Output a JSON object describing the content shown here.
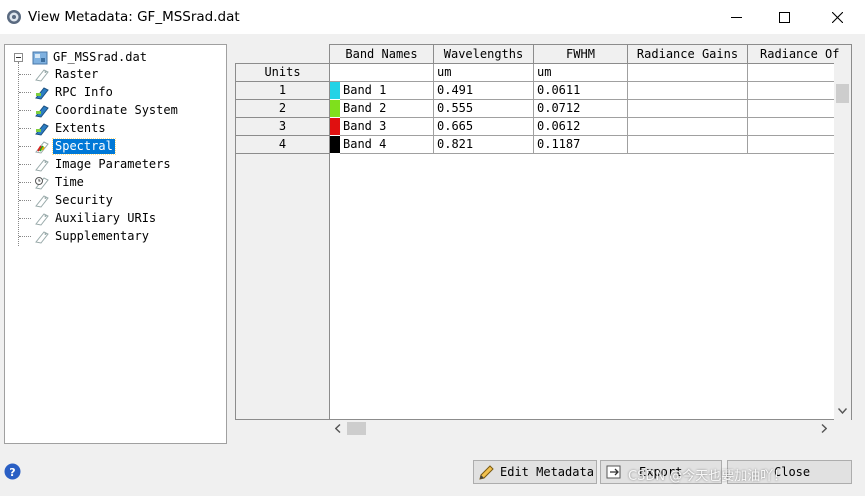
{
  "window": {
    "title": "View Metadata: GF_MSSrad.dat",
    "icon": "envi-gear-icon"
  },
  "tree": {
    "root": "GF_MSSrad.dat",
    "items": [
      {
        "label": "Raster",
        "icon": "tag-blank-icon",
        "selected": false
      },
      {
        "label": "RPC Info",
        "icon": "tag-filled-icon",
        "selected": false
      },
      {
        "label": "Coordinate System",
        "icon": "tag-filled-icon",
        "selected": false
      },
      {
        "label": "Extents",
        "icon": "tag-filled-icon",
        "selected": false
      },
      {
        "label": "Spectral",
        "icon": "tag-color-icon",
        "selected": true
      },
      {
        "label": "Image Parameters",
        "icon": "tag-blank-icon",
        "selected": false
      },
      {
        "label": "Time",
        "icon": "tag-clock-icon",
        "selected": false
      },
      {
        "label": "Security",
        "icon": "tag-blank-icon",
        "selected": false
      },
      {
        "label": "Auxiliary URIs",
        "icon": "tag-blank-icon",
        "selected": false
      },
      {
        "label": "Supplementary",
        "icon": "tag-blank-icon",
        "selected": false
      }
    ]
  },
  "grid": {
    "columns": [
      "Band Names",
      "Wavelengths",
      "FWHM",
      "Radiance Gains",
      "Radiance Of"
    ],
    "units_label": "Units",
    "units": [
      "",
      "um",
      "um",
      "",
      ""
    ],
    "rows": [
      {
        "num": "1",
        "name": "Band 1",
        "color": "#22d3e6",
        "wavelength": "0.491",
        "fwhm": "0.0611",
        "gain": "",
        "offset": ""
      },
      {
        "num": "2",
        "name": "Band 2",
        "color": "#7fe01c",
        "wavelength": "0.555",
        "fwhm": "0.0712",
        "gain": "",
        "offset": ""
      },
      {
        "num": "3",
        "name": "Band 3",
        "color": "#e01010",
        "wavelength": "0.665",
        "fwhm": "0.0612",
        "gain": "",
        "offset": ""
      },
      {
        "num": "4",
        "name": "Band 4",
        "color": "#000000",
        "wavelength": "0.821",
        "fwhm": "0.1187",
        "gain": "",
        "offset": ""
      }
    ]
  },
  "buttons": {
    "edit_metadata": "Edit Metadata",
    "export": "Export",
    "close": "Close"
  },
  "watermark": "CSDN @今天也要加油吖！"
}
